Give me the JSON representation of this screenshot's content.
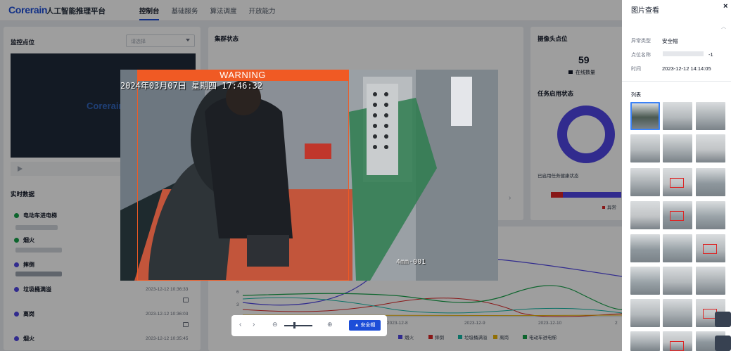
{
  "header": {
    "logo": "Corerain",
    "platform": "人工智能推理平台",
    "nav": [
      "控制台",
      "基础服务",
      "算法调度",
      "开放能力"
    ]
  },
  "monitor": {
    "title": "监控点位",
    "select_placeholder": "请选择",
    "video_logo": "Corerain"
  },
  "realtime": {
    "title": "实时数据",
    "items": [
      {
        "label": "电动车进电梯",
        "color": "#16a34a",
        "time": ""
      },
      {
        "label": "烟火",
        "color": "#16a34a",
        "time": ""
      },
      {
        "label": "摔倒",
        "color": "#4f46e5",
        "time": ""
      },
      {
        "label": "垃圾桶满溢",
        "color": "#4f46e5",
        "time": "2023-12-12 10:36:33"
      },
      {
        "label": "离岗",
        "color": "#4f46e5",
        "time": "2023-12-12 10:36:03"
      },
      {
        "label": "烟火",
        "color": "#4f46e5",
        "time": "2023-12-12 10:35:45"
      }
    ]
  },
  "cluster": {
    "title": "集群状态"
  },
  "camera": {
    "title": "摄像头点位",
    "online_count": "59",
    "online_label": "在线数量",
    "task_title": "任务启用状态",
    "health_label": "已启用任务健康状态",
    "abnormal_label": "异常"
  },
  "trend": {
    "chart_data": {
      "type": "line",
      "x": [
        "2023-12-8",
        "2023-12-9",
        "2023-12-10"
      ],
      "y_ticks": [
        "6",
        "3"
      ],
      "series": [
        {
          "name": "烟火",
          "color": "#4f46e5"
        },
        {
          "name": "摔倒",
          "color": "#dc2626"
        },
        {
          "name": "垃圾桶满溢",
          "color": "#14b8a6"
        },
        {
          "name": "离岗",
          "color": "#eab308"
        },
        {
          "name": "电动车进电梯",
          "color": "#16a34a"
        }
      ]
    }
  },
  "viewer": {
    "warning": "WARNING",
    "osd_datetime": "2024年03月07日  星期四  17:46:32",
    "osd_camera": "4mm-001",
    "tag_button": "安全帽"
  },
  "drawer": {
    "title": "图片查看",
    "close": "×",
    "fields": [
      {
        "label": "异常类型",
        "value": "安全帽"
      },
      {
        "label": "点位名称",
        "value": "-1"
      },
      {
        "label": "时间",
        "value": "2023-12-12 14:14:05"
      }
    ],
    "list_title": "列表"
  }
}
